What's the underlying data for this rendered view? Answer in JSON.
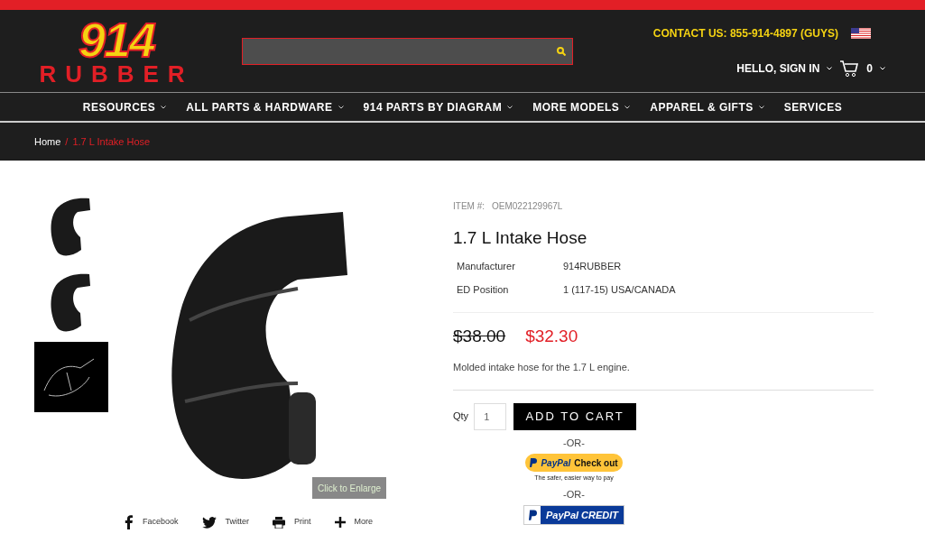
{
  "logo": {
    "number": "914",
    "word": "RUBBER"
  },
  "breadcrumb_separator": "/",
  "contact": "CONTACT US: 855-914-4897 (GUYS)",
  "account": "HELLO, SIGN IN",
  "cart_count": "0",
  "nav": [
    {
      "label": "RESOURCES",
      "dropdown": true
    },
    {
      "label": "ALL PARTS & HARDWARE",
      "dropdown": true
    },
    {
      "label": "914 PARTS BY DIAGRAM",
      "dropdown": true
    },
    {
      "label": "MORE MODELS",
      "dropdown": true
    },
    {
      "label": "APPAREL & GIFTS",
      "dropdown": true
    },
    {
      "label": "SERVICES",
      "dropdown": false
    }
  ],
  "breadcrumbs": [
    {
      "label": "Home",
      "current": false
    },
    {
      "label": "1.7 L Intake Hose",
      "current": true
    }
  ],
  "thumbnails": [
    {
      "kind": "photo"
    },
    {
      "kind": "photo"
    },
    {
      "kind": "diagram"
    }
  ],
  "enlarge": "Click to Enlarge",
  "share": [
    {
      "kind": "facebook",
      "label": "Facebook"
    },
    {
      "kind": "twitter",
      "label": "Twitter"
    },
    {
      "kind": "print",
      "label": "Print"
    },
    {
      "kind": "more",
      "label": "More"
    }
  ],
  "item_label": "ITEM #:",
  "item_number": "OEM022129967L",
  "title": "1.7 L Intake Hose",
  "specs": [
    {
      "name": "Manufacturer",
      "value": "914RUBBER"
    },
    {
      "name": "ED Position",
      "value": "1 (117-15) USA/CANADA"
    }
  ],
  "old_price": "$38.00",
  "price": "$32.30",
  "description": "Molded intake hose for the 1.7 L engine.",
  "qty_label": "Qty",
  "qty": "1",
  "add_to_cart": "ADD TO CART",
  "or": [
    "-OR-",
    "-OR-"
  ],
  "paypal": {
    "brand": "PayPal",
    "action": "Check out",
    "tagline": "The safer, easier way to pay"
  },
  "paypal_credit": {
    "brand": "PayPal",
    "word": "CREDIT"
  }
}
